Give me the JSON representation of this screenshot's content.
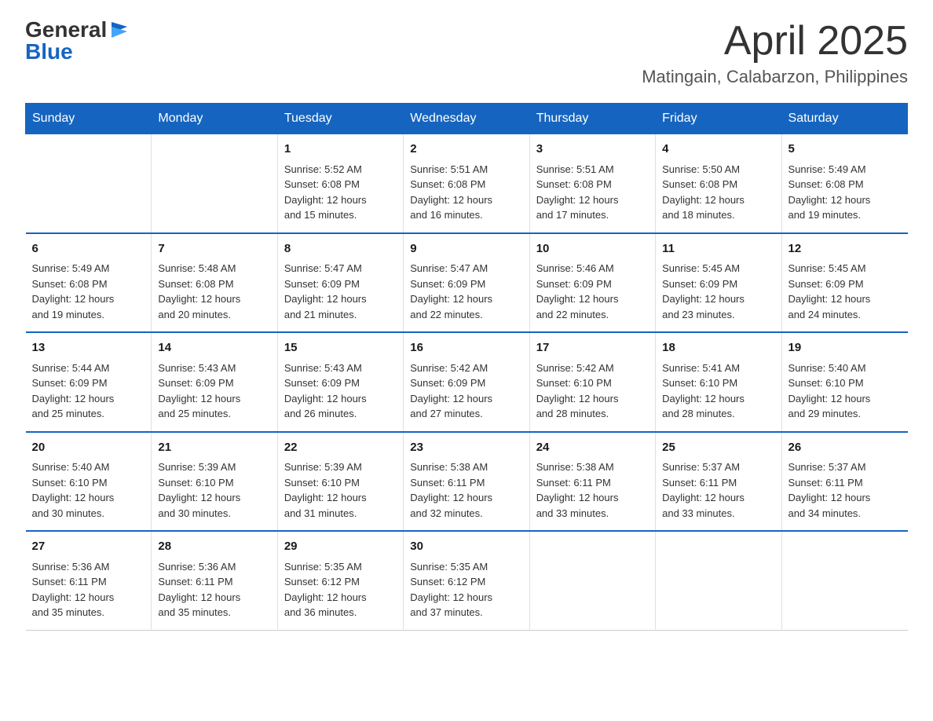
{
  "header": {
    "logo_general": "General",
    "logo_blue": "Blue",
    "month_title": "April 2025",
    "location": "Matingain, Calabarzon, Philippines"
  },
  "days_of_week": [
    "Sunday",
    "Monday",
    "Tuesday",
    "Wednesday",
    "Thursday",
    "Friday",
    "Saturday"
  ],
  "weeks": [
    [
      {
        "day": "",
        "info": ""
      },
      {
        "day": "",
        "info": ""
      },
      {
        "day": "1",
        "info": "Sunrise: 5:52 AM\nSunset: 6:08 PM\nDaylight: 12 hours\nand 15 minutes."
      },
      {
        "day": "2",
        "info": "Sunrise: 5:51 AM\nSunset: 6:08 PM\nDaylight: 12 hours\nand 16 minutes."
      },
      {
        "day": "3",
        "info": "Sunrise: 5:51 AM\nSunset: 6:08 PM\nDaylight: 12 hours\nand 17 minutes."
      },
      {
        "day": "4",
        "info": "Sunrise: 5:50 AM\nSunset: 6:08 PM\nDaylight: 12 hours\nand 18 minutes."
      },
      {
        "day": "5",
        "info": "Sunrise: 5:49 AM\nSunset: 6:08 PM\nDaylight: 12 hours\nand 19 minutes."
      }
    ],
    [
      {
        "day": "6",
        "info": "Sunrise: 5:49 AM\nSunset: 6:08 PM\nDaylight: 12 hours\nand 19 minutes."
      },
      {
        "day": "7",
        "info": "Sunrise: 5:48 AM\nSunset: 6:08 PM\nDaylight: 12 hours\nand 20 minutes."
      },
      {
        "day": "8",
        "info": "Sunrise: 5:47 AM\nSunset: 6:09 PM\nDaylight: 12 hours\nand 21 minutes."
      },
      {
        "day": "9",
        "info": "Sunrise: 5:47 AM\nSunset: 6:09 PM\nDaylight: 12 hours\nand 22 minutes."
      },
      {
        "day": "10",
        "info": "Sunrise: 5:46 AM\nSunset: 6:09 PM\nDaylight: 12 hours\nand 22 minutes."
      },
      {
        "day": "11",
        "info": "Sunrise: 5:45 AM\nSunset: 6:09 PM\nDaylight: 12 hours\nand 23 minutes."
      },
      {
        "day": "12",
        "info": "Sunrise: 5:45 AM\nSunset: 6:09 PM\nDaylight: 12 hours\nand 24 minutes."
      }
    ],
    [
      {
        "day": "13",
        "info": "Sunrise: 5:44 AM\nSunset: 6:09 PM\nDaylight: 12 hours\nand 25 minutes."
      },
      {
        "day": "14",
        "info": "Sunrise: 5:43 AM\nSunset: 6:09 PM\nDaylight: 12 hours\nand 25 minutes."
      },
      {
        "day": "15",
        "info": "Sunrise: 5:43 AM\nSunset: 6:09 PM\nDaylight: 12 hours\nand 26 minutes."
      },
      {
        "day": "16",
        "info": "Sunrise: 5:42 AM\nSunset: 6:09 PM\nDaylight: 12 hours\nand 27 minutes."
      },
      {
        "day": "17",
        "info": "Sunrise: 5:42 AM\nSunset: 6:10 PM\nDaylight: 12 hours\nand 28 minutes."
      },
      {
        "day": "18",
        "info": "Sunrise: 5:41 AM\nSunset: 6:10 PM\nDaylight: 12 hours\nand 28 minutes."
      },
      {
        "day": "19",
        "info": "Sunrise: 5:40 AM\nSunset: 6:10 PM\nDaylight: 12 hours\nand 29 minutes."
      }
    ],
    [
      {
        "day": "20",
        "info": "Sunrise: 5:40 AM\nSunset: 6:10 PM\nDaylight: 12 hours\nand 30 minutes."
      },
      {
        "day": "21",
        "info": "Sunrise: 5:39 AM\nSunset: 6:10 PM\nDaylight: 12 hours\nand 30 minutes."
      },
      {
        "day": "22",
        "info": "Sunrise: 5:39 AM\nSunset: 6:10 PM\nDaylight: 12 hours\nand 31 minutes."
      },
      {
        "day": "23",
        "info": "Sunrise: 5:38 AM\nSunset: 6:11 PM\nDaylight: 12 hours\nand 32 minutes."
      },
      {
        "day": "24",
        "info": "Sunrise: 5:38 AM\nSunset: 6:11 PM\nDaylight: 12 hours\nand 33 minutes."
      },
      {
        "day": "25",
        "info": "Sunrise: 5:37 AM\nSunset: 6:11 PM\nDaylight: 12 hours\nand 33 minutes."
      },
      {
        "day": "26",
        "info": "Sunrise: 5:37 AM\nSunset: 6:11 PM\nDaylight: 12 hours\nand 34 minutes."
      }
    ],
    [
      {
        "day": "27",
        "info": "Sunrise: 5:36 AM\nSunset: 6:11 PM\nDaylight: 12 hours\nand 35 minutes."
      },
      {
        "day": "28",
        "info": "Sunrise: 5:36 AM\nSunset: 6:11 PM\nDaylight: 12 hours\nand 35 minutes."
      },
      {
        "day": "29",
        "info": "Sunrise: 5:35 AM\nSunset: 6:12 PM\nDaylight: 12 hours\nand 36 minutes."
      },
      {
        "day": "30",
        "info": "Sunrise: 5:35 AM\nSunset: 6:12 PM\nDaylight: 12 hours\nand 37 minutes."
      },
      {
        "day": "",
        "info": ""
      },
      {
        "day": "",
        "info": ""
      },
      {
        "day": "",
        "info": ""
      }
    ]
  ]
}
